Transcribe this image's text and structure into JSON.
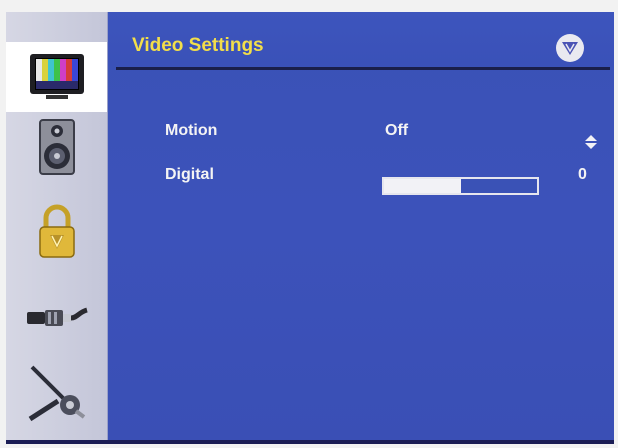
{
  "header": {
    "title": "Video Settings"
  },
  "sidebar": {
    "items": [
      {
        "name": "video",
        "icon": "tv-color-bars-icon",
        "active": true
      },
      {
        "name": "audio",
        "icon": "speaker-icon",
        "active": false
      },
      {
        "name": "parental-lock",
        "icon": "padlock-icon",
        "active": false
      },
      {
        "name": "input",
        "icon": "cable-connector-icon",
        "active": false
      },
      {
        "name": "setup",
        "icon": "wrench-tools-icon",
        "active": false
      }
    ]
  },
  "settings": [
    {
      "label": "Motion",
      "value": "Off",
      "control": "spinner"
    },
    {
      "label": "Digital",
      "value": "0",
      "control": "slider",
      "level": 0.5
    }
  ],
  "colors": {
    "background": "#3a52b6",
    "title": "#f2de4a",
    "text": "#f4f4f4"
  }
}
